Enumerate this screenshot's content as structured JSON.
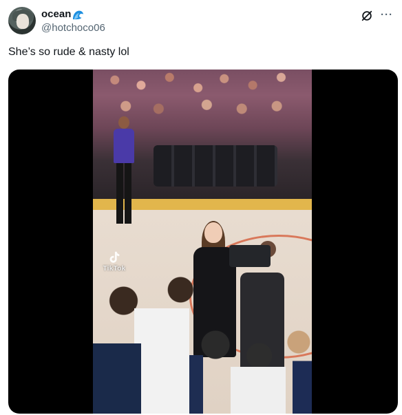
{
  "tweet": {
    "author": {
      "display_name": "ocean",
      "name_emoji": "wave-icon",
      "handle": "@hotchoco06"
    },
    "text": "She’s so rude & nasty lol",
    "actions": {
      "grok_icon": "grok-icon",
      "more_icon": "more-icon",
      "more_label": "···"
    },
    "media": {
      "type": "video",
      "watermark": "TikTok"
    }
  }
}
